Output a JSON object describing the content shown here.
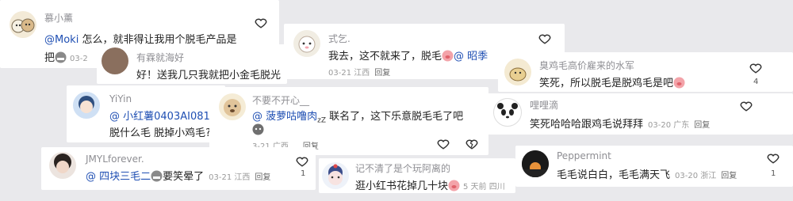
{
  "comments": [
    {
      "name": "慕小薰",
      "mention": "@Moki",
      "text1": " 怎么，就非得让我用个脱毛产品是",
      "text2": "把",
      "date": "03-2"
    },
    {
      "name": "有霖就海好",
      "text": "好！送我几只我就把小金毛脱光"
    },
    {
      "name": "式乞.",
      "text_a": "我去，这不就来了，脱毛",
      "mention": "@ 昭季",
      "date": "03-21",
      "loc": "江西",
      "reply": "回复"
    },
    {
      "name": "臭鸡毛高价雇来的水军",
      "text": "笑死，所以脱毛是脱鸡毛是吧",
      "likes": "4"
    },
    {
      "name": "YiYin",
      "mention": "@ 小红薯0403AI081",
      "text2": "脱什么毛 脱掉小鸡毛?"
    },
    {
      "name": "不要不开心__",
      "mention": "@ 菠萝咕噜肉",
      "zzz": "zZ",
      "text_b": " 联名了，这下乐意脱毛毛了吧",
      "date": "3-21",
      "loc": "广西",
      "reply": "回复"
    },
    {
      "name": "哩哩滴",
      "text": "笑死哈哈哈跟鸡毛说拜拜",
      "date": "03-20",
      "loc": "广东",
      "reply": "回复"
    },
    {
      "name": "JMYLforever.",
      "mention": "@ 四块三毛二",
      "text_b": "要笑晕了",
      "date": "03-21",
      "loc": "江西",
      "reply": "回复",
      "likes": "1"
    },
    {
      "name": "记不清了是个玩阿离的",
      "text": "逛小红书花掉几十块",
      "date": "5 天前",
      "loc": "四川"
    },
    {
      "name": "Peppermint",
      "text": "毛毛说白白，毛毛满天飞",
      "date": "03-20",
      "loc": "浙江",
      "reply": "回复",
      "likes": "1"
    }
  ]
}
